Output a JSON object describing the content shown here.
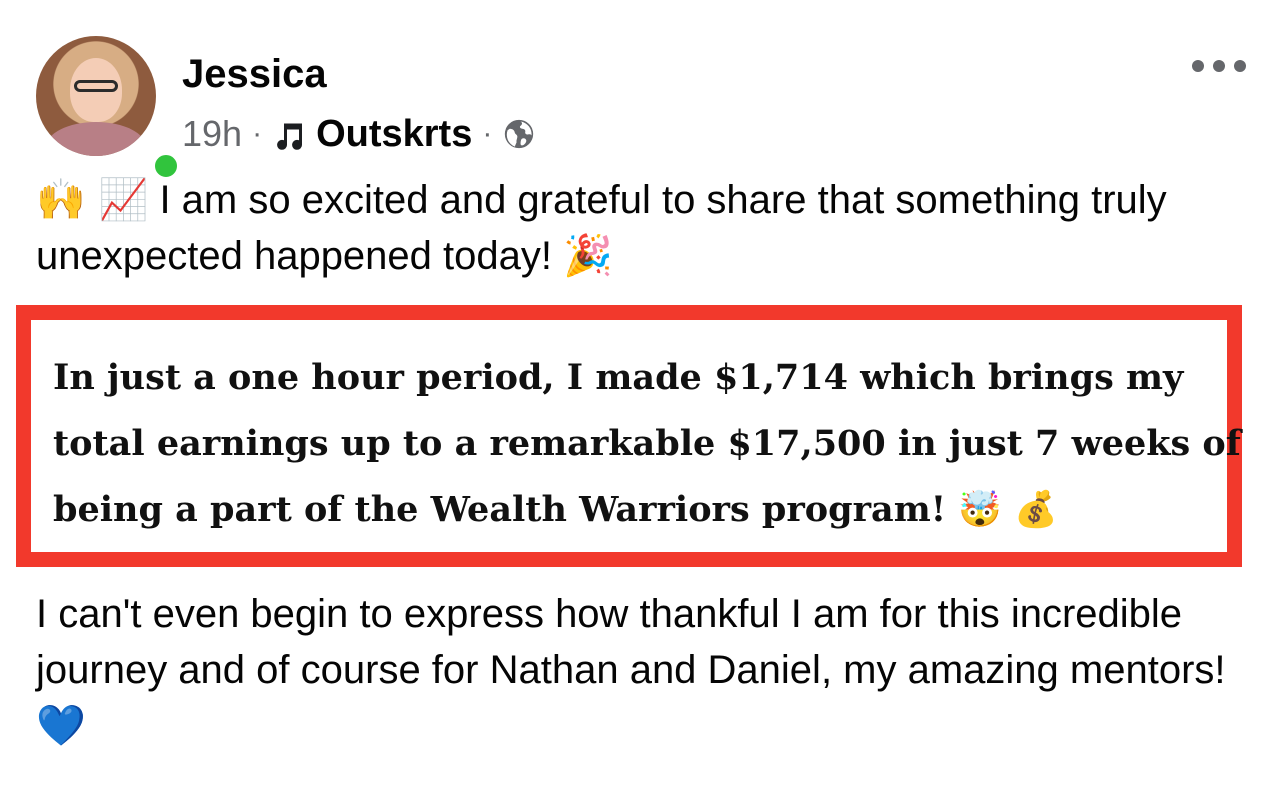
{
  "post": {
    "author": "Jessica",
    "time": "19h",
    "meta_separator": "·",
    "source": "Outskrts",
    "audience_icon": "globe-icon",
    "source_icon": "music-note-icon",
    "more_icon": "more-options-icon",
    "intro_emoji": "🙌 📈",
    "intro_text": "I am so excited and grateful to share that something truly unexpected happened today!",
    "intro_end_emoji": "🎉",
    "highlight_text": "In just a one hour period, I made $1,714 which brings my total earnings up to a remarkable $17,500 in just 7 weeks of being a part of the Wealth Warriors program!",
    "highlight_emoji": "🤯 💰",
    "closing_text": "I can't even begin to express how thankful I am for this incredible journey and of course for Nathan and Daniel, my amazing mentors!",
    "closing_emoji": "💙",
    "highlight_color": "#f2392c",
    "online_color": "#31c43d"
  }
}
